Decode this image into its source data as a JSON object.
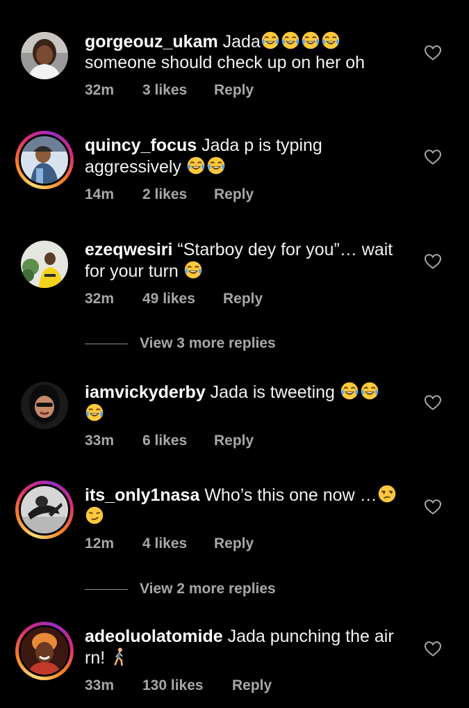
{
  "comments": [
    {
      "username": "gorgeouz_ukam",
      "line1": "Jada",
      "line1_emojis": [
        "joy-emoji",
        "joy-emoji",
        "joy-emoji",
        "joy-emoji"
      ],
      "line2": "someone should check up on her oh",
      "line2_emojis": [],
      "time": "32m",
      "likes": "3 likes",
      "reply": "Reply",
      "story_ring": false,
      "avatar": "avatar-woman-white-top"
    },
    {
      "username": "quincy_focus",
      "line1": "Jada p is typing",
      "line1_emojis": [],
      "line2": "aggressively",
      "line2_emojis": [
        "joy-emoji",
        "joy-emoji"
      ],
      "time": "14m",
      "likes": "2 likes",
      "reply": "Reply",
      "story_ring": true,
      "avatar": "avatar-person-blue"
    },
    {
      "username": "ezeqwesiri",
      "line1": "“Starboy dey for you”… wait",
      "line1_emojis": [],
      "line2": "for your turn",
      "line2_emojis": [
        "joy-emoji"
      ],
      "time": "32m",
      "likes": "49 likes",
      "reply": "Reply",
      "story_ring": false,
      "avatar": "avatar-man-yellow-shirt"
    },
    {
      "username": "iamvickyderby",
      "line1": "Jada is tweeting",
      "line1_emojis": [
        "joy-emoji",
        "joy-emoji"
      ],
      "line2": "",
      "line2_emojis": [
        "joy-emoji"
      ],
      "time": "33m",
      "likes": "6 likes",
      "reply": "Reply",
      "story_ring": false,
      "avatar": "avatar-woman-dark"
    },
    {
      "username": "its_only1nasa",
      "line1": "Who’s this one now …",
      "line1_emojis": [
        "unamused-emoji"
      ],
      "line2": "",
      "line2_emojis": [
        "smirk-emoji"
      ],
      "time": "12m",
      "likes": "4 likes",
      "reply": "Reply",
      "story_ring": true,
      "avatar": "avatar-person-lying"
    },
    {
      "username": "adeoluolatomide",
      "line1": "Jada punching the air",
      "line1_emojis": [],
      "line2": "rn!",
      "line2_emojis": [
        "walking-person-emoji"
      ],
      "time": "33m",
      "likes": "130 likes",
      "reply": "Reply",
      "story_ring": true,
      "avatar": "avatar-woman-red"
    }
  ],
  "view_replies": [
    {
      "label": "View 3 more replies"
    },
    {
      "label": "View 2 more replies"
    }
  ],
  "colors": {
    "background": "#000000",
    "text": "#f2f2f2",
    "meta": "#a8a8a8",
    "divider": "#8e8e8e",
    "emoji_face": "#ffc83d",
    "tear": "#4aa7ff"
  },
  "icons": {
    "like": "heart-outline-icon"
  }
}
